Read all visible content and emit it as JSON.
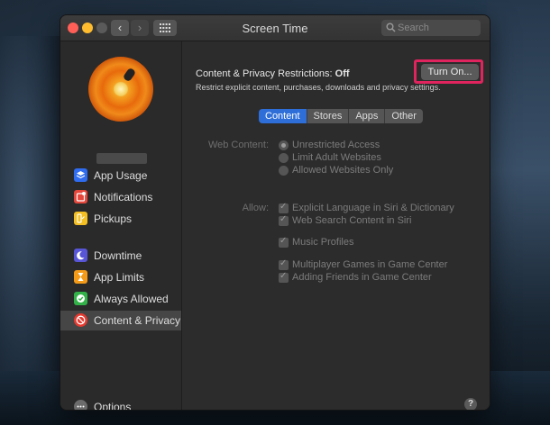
{
  "window": {
    "title": "Screen Time"
  },
  "toolbar": {
    "back": "‹",
    "forward": "›",
    "search_placeholder": "Search"
  },
  "sidebar": {
    "items": [
      {
        "label": "App Usage",
        "icon": "layers-icon"
      },
      {
        "label": "Notifications",
        "icon": "notification-icon"
      },
      {
        "label": "Pickups",
        "icon": "pickup-icon"
      },
      {
        "label": "Downtime",
        "icon": "moon-icon"
      },
      {
        "label": "App Limits",
        "icon": "hourglass-icon"
      },
      {
        "label": "Always Allowed",
        "icon": "check-badge-icon"
      },
      {
        "label": "Content & Privacy",
        "icon": "no-entry-icon",
        "selected": true
      }
    ],
    "options_label": "Options"
  },
  "main": {
    "title_prefix": "Content & Privacy Restrictions: ",
    "title_status": "Off",
    "subtitle": "Restrict explicit content, purchases, downloads and privacy settings.",
    "turn_on_label": "Turn On...",
    "tabs": [
      "Content",
      "Stores",
      "Apps",
      "Other"
    ],
    "active_tab": "Content",
    "web_content": {
      "label": "Web Content:",
      "options": [
        "Unrestricted Access",
        "Limit Adult Websites",
        "Allowed Websites Only"
      ],
      "selected": "Unrestricted Access"
    },
    "allow": {
      "label": "Allow:",
      "items": [
        "Explicit Language in Siri & Dictionary",
        "Web Search Content in Siri",
        "Music Profiles",
        "Multiplayer Games in Game Center",
        "Adding Friends in Game Center"
      ]
    },
    "help_label": "?"
  },
  "colors": {
    "accent": "#2d6ed8",
    "highlight": "#e0245e"
  }
}
